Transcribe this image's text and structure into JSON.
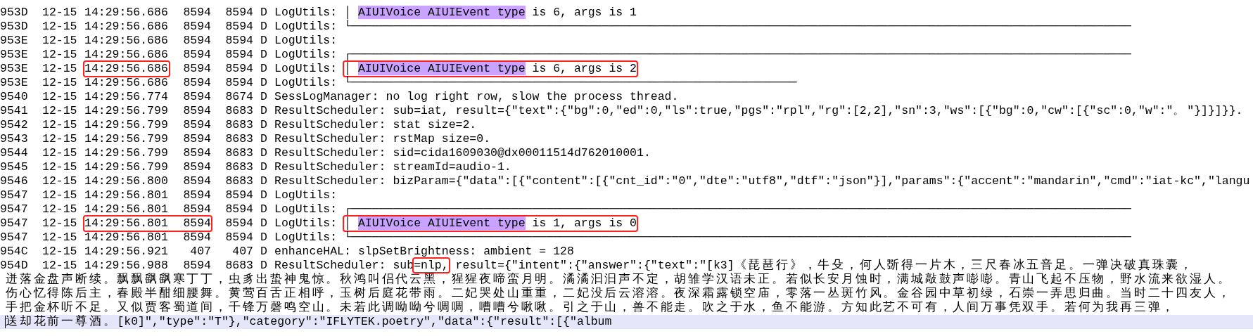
{
  "log_rows": [
    {
      "id": "953D",
      "date": "12-15",
      "time": "14:29:56.686",
      "pid": "8594",
      "tid": "8594",
      "level": "D",
      "tag": "LogUtils:",
      "message": [
        {
          "text": "│ ",
          "highlighted": false
        },
        {
          "text": "AIUIVoice AIUIEvent type",
          "highlighted": true
        },
        {
          "text": " is 6, args is 1",
          "highlighted": false
        }
      ]
    },
    {
      "id": "953D",
      "date": "12-15",
      "time": "14:29:56.686",
      "pid": "8594",
      "tid": "8594",
      "level": "D",
      "tag": "LogUtils:",
      "message": [
        {
          "text": "└────────────────────────────────────────────────────────────────────────────────────────────────────────────────",
          "highlighted": false
        }
      ]
    },
    {
      "id": "953E",
      "date": "12-15",
      "time": "14:29:56.686",
      "pid": "8594",
      "tid": "8594",
      "level": "D",
      "tag": "LogUtils:"
    },
    {
      "id": "953E",
      "date": "12-15",
      "time": "14:29:56.686",
      "pid": "8594",
      "tid": "8594",
      "level": "D",
      "tag": "LogUtils:",
      "message": [
        {
          "text": "┌────────────────────────────────────────────────────────────────────────────────────────────────────────────────",
          "highlighted": false
        }
      ]
    },
    {
      "id": "953E",
      "date": "12-15",
      "time": "14:29:56.686",
      "pid": "8594",
      "tid": "8594",
      "level": "D",
      "tag": "LogUtils:",
      "time_framed": true,
      "pid_framed": false,
      "message_framed": true,
      "message": [
        {
          "text": "│ ",
          "highlighted": false
        },
        {
          "text": "AIUIVoice AIUIEvent type",
          "highlighted": true
        },
        {
          "text": " is 6, args is 2",
          "highlighted": false
        }
      ]
    },
    {
      "id": "953E",
      "date": "12-15",
      "time": "14:29:56.686",
      "pid": "8594",
      "tid": "8594",
      "level": "D",
      "tag": "LogUtils:",
      "message": [
        {
          "text": "└────────────────────────────────────────────────────────────────",
          "highlighted": false
        }
      ]
    },
    {
      "id": "9540",
      "date": "12-15",
      "time": "14:29:56.774",
      "pid": "8594",
      "tid": "8674",
      "level": "D",
      "tag": "SessLogManager:",
      "message": [
        {
          "text": "no log right row, slow the process thread.",
          "highlighted": false
        }
      ]
    },
    {
      "id": "9541",
      "date": "12-15",
      "time": "14:29:56.799",
      "pid": "8594",
      "tid": "8683",
      "level": "D",
      "tag": "ResultScheduler:",
      "message": [
        {
          "text": "sub=iat, result={\"text\":{\"bg\":0,\"ed\":0,\"ls\":true,\"pgs\":\"rpl\",\"rg\":[2,2],\"sn\":3,\"ws\":[{\"bg\":0,\"cw\":[{\"sc\":0,\"w\":\"。\"}]}]}}.",
          "highlighted": false
        }
      ]
    },
    {
      "id": "9542",
      "date": "12-15",
      "time": "14:29:56.799",
      "pid": "8594",
      "tid": "8683",
      "level": "D",
      "tag": "ResultScheduler:",
      "message": [
        {
          "text": "stat size=2.",
          "highlighted": false
        }
      ]
    },
    {
      "id": "9543",
      "date": "12-15",
      "time": "14:29:56.799",
      "pid": "8594",
      "tid": "8683",
      "level": "D",
      "tag": "ResultScheduler:",
      "message": [
        {
          "text": "rstMap size=0.",
          "highlighted": false
        }
      ]
    },
    {
      "id": "9544",
      "date": "12-15",
      "time": "14:29:56.799",
      "pid": "8594",
      "tid": "8683",
      "level": "D",
      "tag": "ResultScheduler:",
      "message": [
        {
          "text": "sid=cida1609030@dx00011514d762010001.",
          "highlighted": false
        }
      ]
    },
    {
      "id": "9545",
      "date": "12-15",
      "time": "14:29:56.799",
      "pid": "8594",
      "tid": "8683",
      "level": "D",
      "tag": "ResultScheduler:",
      "message": [
        {
          "text": "streamId=audio-1.",
          "highlighted": false
        }
      ]
    },
    {
      "id": "9546",
      "date": "12-15",
      "time": "14:29:56.800",
      "pid": "8594",
      "tid": "8683",
      "level": "D",
      "tag": "ResultScheduler:",
      "message": [
        {
          "text": "bizParam={\"data\":[{\"content\":[{\"cnt_id\":\"0\",\"dte\":\"utf8\",\"dtf\":\"json\"}],\"params\":{\"accent\":\"mandarin\",\"cmd\":\"iat-kc\",\"langu",
          "highlighted": false
        }
      ]
    },
    {
      "id": "9547",
      "date": "12-15",
      "time": "14:29:56.801",
      "pid": "8594",
      "tid": "8594",
      "level": "D",
      "tag": "LogUtils:"
    },
    {
      "id": "9547",
      "date": "12-15",
      "time": "14:29:56.801",
      "pid": "8594",
      "tid": "8594",
      "level": "D",
      "tag": "LogUtils:",
      "message": [
        {
          "text": "┌────────────────────────────────────────────────────────────────────────────────────────────────────────────────",
          "highlighted": false
        }
      ]
    },
    {
      "id": "9547",
      "date": "12-15",
      "time": "14:29:56.801",
      "pid": "8594",
      "tid": "8594",
      "level": "D",
      "tag": "LogUtils:",
      "time_framed": true,
      "pid_framed": true,
      "message_framed": true,
      "message": [
        {
          "text": "│ ",
          "highlighted": false
        },
        {
          "text": "AIUIVoice AIUIEvent type",
          "highlighted": true
        },
        {
          "text": " is 1, args is 0",
          "highlighted": false
        }
      ]
    },
    {
      "id": "9547",
      "date": "12-15",
      "time": "14:29:56.801",
      "pid": "8594",
      "tid": "8594",
      "level": "D",
      "tag": "LogUtils:",
      "message": [
        {
          "text": "└────────────────────────────────────────────────────────────────────────────────────────────────────────────────",
          "highlighted": false
        }
      ]
    },
    {
      "id": "954C",
      "date": "12-15",
      "time": "14:29:56.921",
      "pid": "407",
      "tid": "407",
      "level": "D",
      "tag": "enhanceHAL:",
      "message": [
        {
          "text": "slpSetBrightness: ambient = 128",
          "highlighted": false
        }
      ]
    },
    {
      "id": "954D",
      "date": "12-15",
      "time": "14:29:56.988",
      "pid": "8594",
      "tid": "8683",
      "level": "D",
      "tag": "ResultScheduler:",
      "message": [
        {
          "text": "sub",
          "highlighted": false,
          "framed": false
        },
        {
          "text": "=nlp,",
          "highlighted": false,
          "framed": true
        },
        {
          "text": " result={\"intent\":{\"answer\":{\"text\":\"[k3]《琵琶行》，牛殳，何人斲得一片木，三尺春冰五音足。一弹决破真珠囊，",
          "highlighted": false,
          "framed": false
        }
      ],
      "continuation_lines": [
        {
          "text": "迸落金盘声断续。飘飘飖飖寒丁丁，虫豸出蛰神鬼惊。秋鸿叫侣代云黑，猩猩夜啼蛮月明。潏潏汩汩声不定，胡雏学汉语未正。若似长安月蚀时，满城敲鼓声嘭嘭。青山飞起不压物，野水流来欲湿人。",
          "current": false
        },
        {
          "text": "伤心忆得陈后主，春殿半酣细腰舞。黄莺百舌正相呼，玉树后庭花带雨。二妃哭处山重重，二妃没后云溶溶。夜深霜露锁空庙，零落一丛斑竹风。金谷园中草初绿，石崇一弄思归曲。当时二十四友人，",
          "current": false
        },
        {
          "text": "手把金杯听不足。又似贾客蜀道间，千锋万磬鸣空山。未若此调呦呦兮啁啁，嘈嘈兮啾啾。引之于山，兽不能走。吹之于水，鱼不能游。方知此艺不可有，人间万事凭双手。若何为我再三弹，",
          "current": false
        },
        {
          "text": "送却花前一尊酒。[k0]\",\"type\":\"T\"},\"category\":\"IFLYTEK.poetry\",\"data\":{\"result\":[{\"album",
          "current": true
        }
      ]
    }
  ]
}
